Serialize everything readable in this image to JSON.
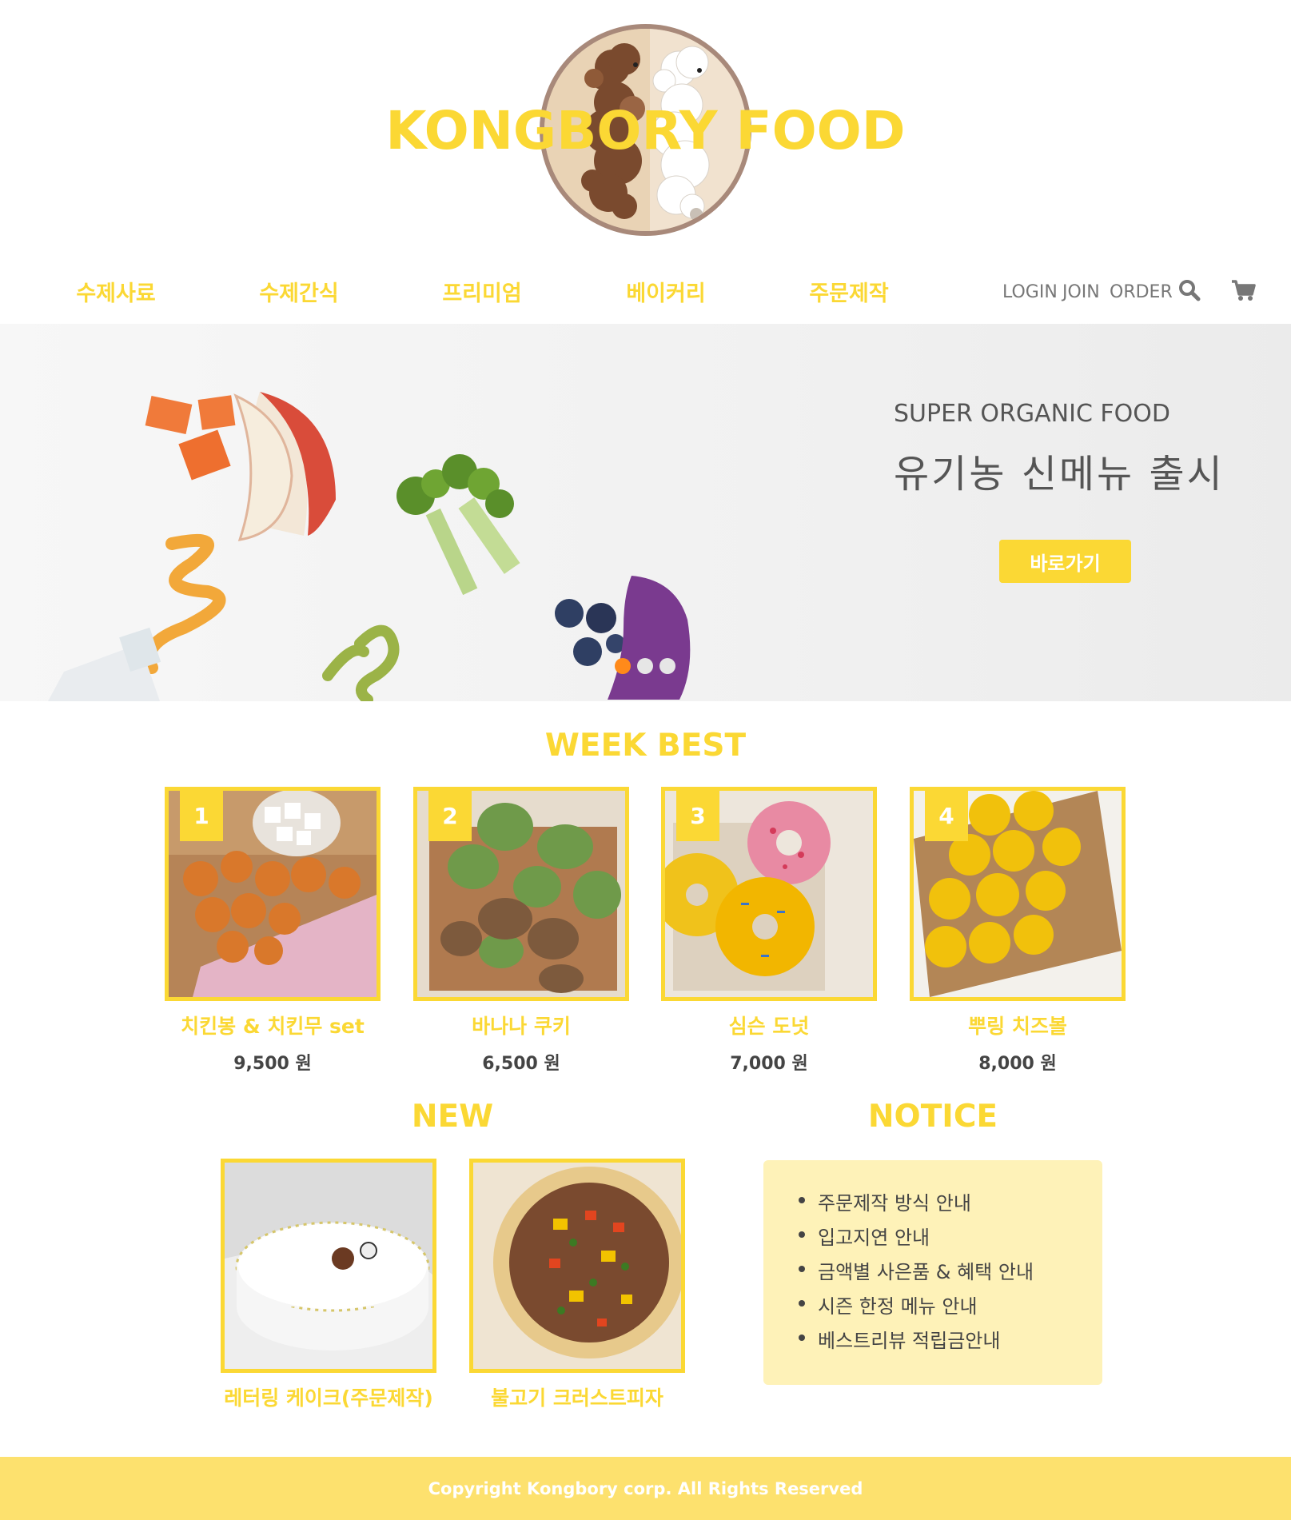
{
  "brand": {
    "name": "KONGBORY FOOD"
  },
  "nav": {
    "items": [
      {
        "label": "수제사료"
      },
      {
        "label": "수제간식"
      },
      {
        "label": "프리미엄"
      },
      {
        "label": "베이커리"
      },
      {
        "label": "주문제작"
      }
    ],
    "login": "LOGIN",
    "join": "JOIN",
    "order": "ORDER",
    "icons": [
      "search-icon",
      "cart-icon"
    ]
  },
  "hero": {
    "subtitle": "SUPER ORGANIC FOOD",
    "title": "유기농 신메뉴 출시",
    "button": "바로가기",
    "slides": 3,
    "active_slide": 1
  },
  "week_best": {
    "title": "WEEK BEST",
    "items": [
      {
        "rank": "1",
        "name": "치킨봉 & 치킨무 set",
        "price": "9,500 원"
      },
      {
        "rank": "2",
        "name": "바나나 쿠키",
        "price": "6,500 원"
      },
      {
        "rank": "3",
        "name": "심슨 도넛",
        "price": "7,000 원"
      },
      {
        "rank": "4",
        "name": "뿌링 치즈볼",
        "price": "8,000 원"
      }
    ]
  },
  "new": {
    "title": "NEW",
    "items": [
      {
        "name": "레터링 케이크(주문제작)"
      },
      {
        "name": "불고기 크러스트피자"
      }
    ]
  },
  "notice": {
    "title": "NOTICE",
    "items": [
      "주문제작 방식 안내",
      "입고지연 안내",
      "금액별 사은품 & 혜택 안내",
      "시즌 한정 메뉴 안내",
      "베스트리뷰 적립금안내"
    ]
  },
  "footer": {
    "copyright": "Copyright Kongbory corp. All Rights Reserved"
  },
  "colors": {
    "accent": "#fbd834",
    "notice_bg": "#fef2b8",
    "footer_bg": "#fde16e",
    "active_dot": "#ff8a1a"
  }
}
